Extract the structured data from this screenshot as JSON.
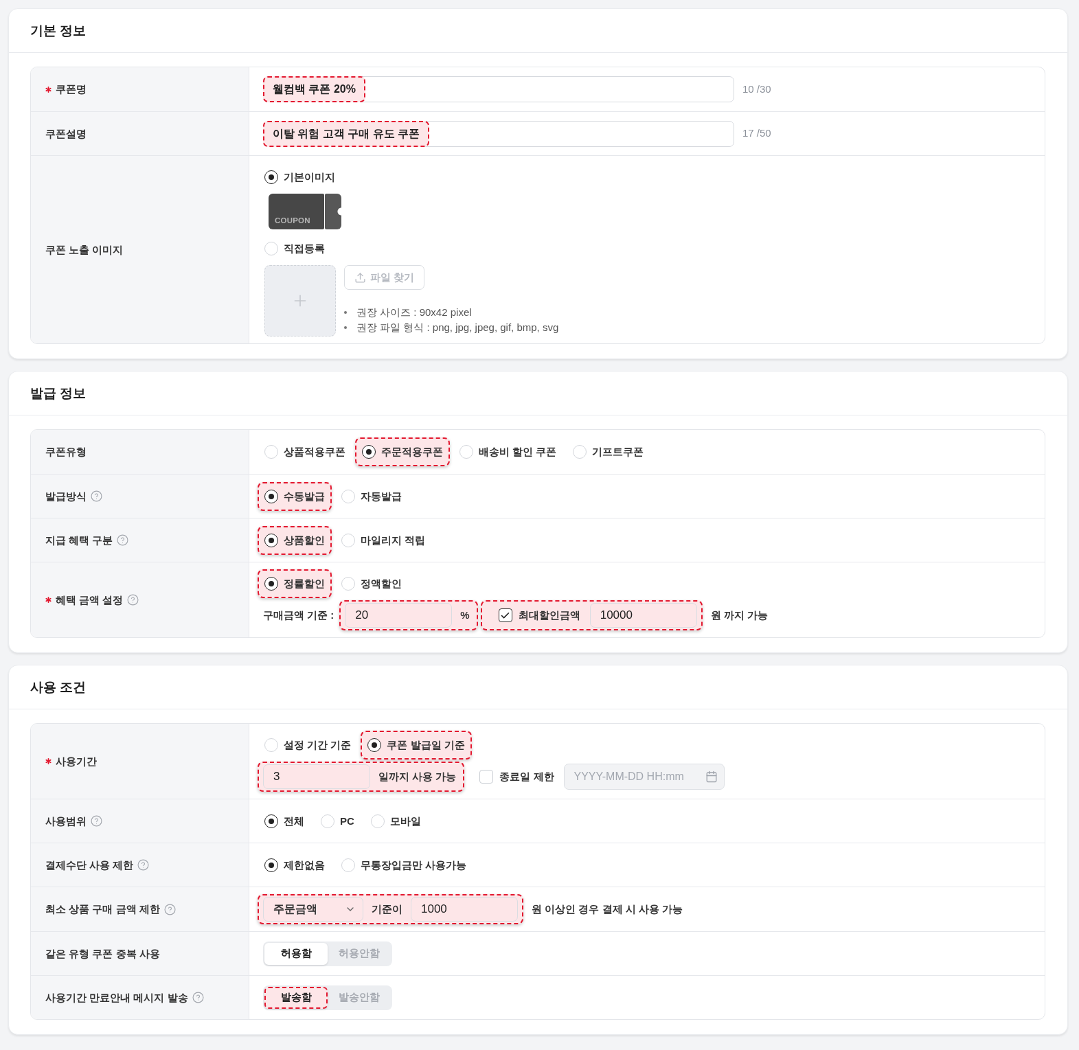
{
  "sections": [
    {
      "title": "기본 정보",
      "rows": [
        {
          "label": "쿠폰명",
          "required": true,
          "help": false,
          "lines": [
            [
              {
                "kind": "text_field",
                "value": "웰컴백 쿠폰 20%",
                "highlighted": true
              },
              {
                "kind": "counter",
                "text": "10 /30"
              }
            ]
          ]
        },
        {
          "label": "쿠폰설명",
          "required": false,
          "help": false,
          "lines": [
            [
              {
                "kind": "text_field",
                "value": "이탈 위험 고객 구매 유도 쿠폰",
                "highlighted": true
              },
              {
                "kind": "counter",
                "text": "17 /50"
              }
            ]
          ]
        },
        {
          "label": "쿠폰 노출 이미지",
          "required": false,
          "help": false,
          "lines": [
            [
              {
                "kind": "radio",
                "label": "기본이미지",
                "selected": true,
                "highlighted": false
              }
            ],
            [
              {
                "kind": "coupon_image",
                "text": "COUPON"
              }
            ],
            [
              {
                "kind": "radio",
                "label": "직접등록",
                "selected": false,
                "highlighted": false
              }
            ],
            [
              {
                "kind": "upload",
                "button": "파일 찾기",
                "disabled": true,
                "notes": [
                  "권장 사이즈 : 90x42 pixel",
                  "권장 파일 형식 : png, jpg, jpeg, gif, bmp, svg"
                ]
              }
            ]
          ]
        }
      ]
    },
    {
      "title": "발급 정보",
      "rows": [
        {
          "label": "쿠폰유형",
          "required": false,
          "help": false,
          "lines": [
            [
              {
                "kind": "radio",
                "label": "상품적용쿠폰",
                "selected": false,
                "highlighted": false
              },
              {
                "kind": "radio",
                "label": "주문적용쿠폰",
                "selected": true,
                "highlighted": true
              },
              {
                "kind": "radio",
                "label": "배송비 할인 쿠폰",
                "selected": false,
                "highlighted": false
              },
              {
                "kind": "radio",
                "label": "기프트쿠폰",
                "selected": false,
                "highlighted": false
              }
            ]
          ]
        },
        {
          "label": "발급방식",
          "required": false,
          "help": true,
          "lines": [
            [
              {
                "kind": "radio",
                "label": "수동발급",
                "selected": true,
                "highlighted": true
              },
              {
                "kind": "radio",
                "label": "자동발급",
                "selected": false,
                "highlighted": false
              }
            ]
          ]
        },
        {
          "label": "지급 혜택 구분",
          "required": false,
          "help": true,
          "lines": [
            [
              {
                "kind": "radio",
                "label": "상품할인",
                "selected": true,
                "highlighted": true
              },
              {
                "kind": "radio",
                "label": "마일리지 적립",
                "selected": false,
                "highlighted": false
              }
            ]
          ]
        },
        {
          "label": "혜택 금액 설정",
          "required": true,
          "help": true,
          "lines": [
            [
              {
                "kind": "radio",
                "label": "정률할인",
                "selected": true,
                "highlighted": true
              },
              {
                "kind": "radio",
                "label": "정액할인",
                "selected": false,
                "highlighted": false
              }
            ],
            [
              {
                "kind": "text",
                "text": "구매금액 기준 :"
              },
              {
                "kind": "group",
                "highlighted": true,
                "items": [
                  {
                    "kind": "number_field",
                    "value": "20"
                  },
                  {
                    "kind": "text",
                    "text": "%"
                  }
                ]
              },
              {
                "kind": "group",
                "highlighted": true,
                "items": [
                  {
                    "kind": "checkbox",
                    "label": "최대할인금액",
                    "checked": true
                  },
                  {
                    "kind": "number_field",
                    "value": "10000"
                  }
                ]
              },
              {
                "kind": "text",
                "text": "원 까지 가능"
              }
            ]
          ]
        }
      ]
    },
    {
      "title": "사용 조건",
      "rows": [
        {
          "label": "사용기간",
          "required": true,
          "help": false,
          "lines": [
            [
              {
                "kind": "radio",
                "label": "설정 기간 기준",
                "selected": false,
                "highlighted": false
              },
              {
                "kind": "radio",
                "label": "쿠폰 발급일 기준",
                "selected": true,
                "highlighted": true
              }
            ],
            [
              {
                "kind": "group",
                "highlighted": true,
                "items": [
                  {
                    "kind": "number_field",
                    "value": "3"
                  },
                  {
                    "kind": "text",
                    "text": "일까지 사용 가능"
                  }
                ]
              },
              {
                "kind": "checkbox",
                "label": "종료일 제한",
                "checked": false
              },
              {
                "kind": "date_field",
                "placeholder": "YYYY-MM-DD HH:mm",
                "disabled": true
              }
            ]
          ]
        },
        {
          "label": "사용범위",
          "required": false,
          "help": true,
          "lines": [
            [
              {
                "kind": "radio",
                "label": "전체",
                "selected": true,
                "highlighted": false
              },
              {
                "kind": "radio",
                "label": "PC",
                "selected": false,
                "highlighted": false
              },
              {
                "kind": "radio",
                "label": "모바일",
                "selected": false,
                "highlighted": false
              }
            ]
          ]
        },
        {
          "label": "결제수단 사용 제한",
          "required": false,
          "help": true,
          "lines": [
            [
              {
                "kind": "radio",
                "label": "제한없음",
                "selected": true,
                "highlighted": false
              },
              {
                "kind": "radio",
                "label": "무통장입금만 사용가능",
                "selected": false,
                "highlighted": false
              }
            ]
          ]
        },
        {
          "label": "최소 상품 구매 금액 제한",
          "required": false,
          "help": true,
          "lines": [
            [
              {
                "kind": "group",
                "highlighted": true,
                "items": [
                  {
                    "kind": "select",
                    "value": "주문금액"
                  },
                  {
                    "kind": "text",
                    "text": "기준이"
                  },
                  {
                    "kind": "number_field",
                    "value": "1000"
                  }
                ]
              },
              {
                "kind": "text",
                "text": "원 이상인 경우 결제 시 사용 가능"
              }
            ]
          ]
        },
        {
          "label": "같은 유형 쿠폰 중복 사용",
          "required": false,
          "help": false,
          "lines": [
            [
              {
                "kind": "segmented",
                "options": [
                  {
                    "label": "허용함",
                    "selected": true,
                    "highlighted": false
                  },
                  {
                    "label": "허용안함",
                    "selected": false,
                    "highlighted": false
                  }
                ]
              }
            ]
          ]
        },
        {
          "label": "사용기간 만료안내 메시지 발송",
          "required": false,
          "help": true,
          "lines": [
            [
              {
                "kind": "segmented",
                "options": [
                  {
                    "label": "발송함",
                    "selected": true,
                    "highlighted": true
                  },
                  {
                    "label": "발송안함",
                    "selected": false,
                    "highlighted": false
                  }
                ]
              }
            ]
          ]
        }
      ]
    }
  ]
}
